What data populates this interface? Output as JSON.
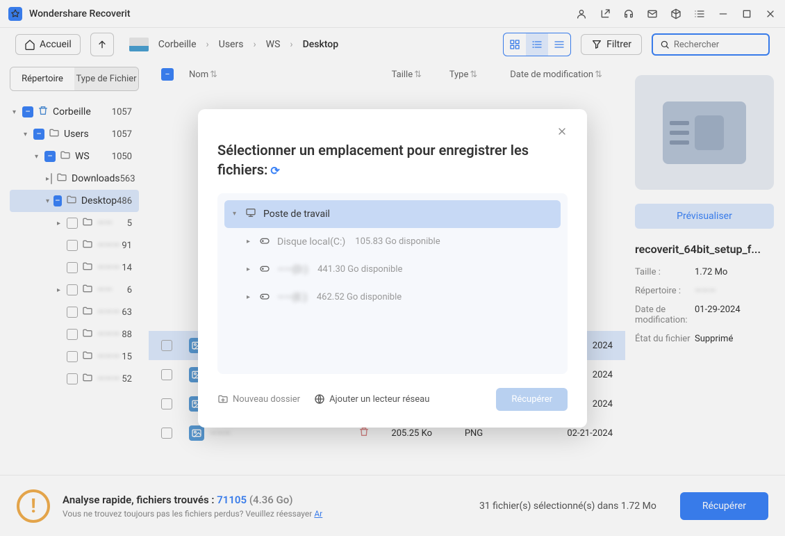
{
  "app": {
    "title": "Wondershare Recoverit"
  },
  "toolbar": {
    "home": "Accueil",
    "breadcrumbs": [
      "Corbeille",
      "Users",
      "WS",
      "Desktop"
    ],
    "filter": "Filtrer",
    "search_placeholder": "Rechercher"
  },
  "sidebar": {
    "tabs": {
      "dir": "Répertoire",
      "type": "Type de Fichier"
    },
    "tree": [
      {
        "indent": 0,
        "tri": "▾",
        "chk": "minus",
        "icon": "trash",
        "label": "Corbeille",
        "count": "1057"
      },
      {
        "indent": 1,
        "tri": "▾",
        "chk": "minus",
        "icon": "folder",
        "label": "Users",
        "count": "1057"
      },
      {
        "indent": 2,
        "tri": "▾",
        "chk": "minus",
        "icon": "folder",
        "label": "WS",
        "count": "1050"
      },
      {
        "indent": 3,
        "tri": "▸",
        "chk": "",
        "icon": "folder",
        "label": "Downloads",
        "count": "563"
      },
      {
        "indent": 3,
        "tri": "▾",
        "chk": "minus",
        "icon": "folder",
        "label": "Desktop",
        "count": "486",
        "sel": true
      },
      {
        "indent": 4,
        "tri": "▸",
        "chk": "",
        "icon": "folder",
        "label": "——",
        "count": "5",
        "blur": true
      },
      {
        "indent": 4,
        "tri": "",
        "chk": "",
        "icon": "folder",
        "label": "———",
        "count": "91",
        "blur": true
      },
      {
        "indent": 4,
        "tri": "",
        "chk": "",
        "icon": "folder",
        "label": "———",
        "count": "14",
        "blur": true
      },
      {
        "indent": 4,
        "tri": "▸",
        "chk": "",
        "icon": "folder",
        "label": "——",
        "count": "6",
        "blur": true
      },
      {
        "indent": 4,
        "tri": "",
        "chk": "",
        "icon": "folder",
        "label": "———",
        "count": "63",
        "blur": true
      },
      {
        "indent": 4,
        "tri": "",
        "chk": "",
        "icon": "folder",
        "label": "———",
        "count": "88",
        "blur": true
      },
      {
        "indent": 4,
        "tri": "",
        "chk": "",
        "icon": "folder",
        "label": "———",
        "count": "15",
        "blur": true
      },
      {
        "indent": 4,
        "tri": "",
        "chk": "",
        "icon": "folder",
        "label": "———",
        "count": "52",
        "blur": true
      }
    ]
  },
  "filelist": {
    "headers": {
      "nom": "Nom",
      "taille": "Taille",
      "type": "Type",
      "date": "Date de modification"
    },
    "rows": [
      {
        "name": "———",
        "size": "",
        "type": "",
        "date": "2024",
        "sel": true
      },
      {
        "name": "———",
        "size": "",
        "type": "",
        "date": "2024"
      },
      {
        "name": "———",
        "size": "",
        "type": "",
        "date": "2024"
      },
      {
        "name": "———",
        "size": "205.25 Ko",
        "type": "PNG",
        "date": "02-21-2024"
      }
    ]
  },
  "preview": {
    "btn": "Prévisualiser",
    "filename": "recoverit_64bit_setup_f...",
    "meta": [
      {
        "k": "Taille :",
        "v": "1.72 Mo"
      },
      {
        "k": "Répertoire :",
        "v": "———",
        "blur": true
      },
      {
        "k": "Date de modification:",
        "v": "01-29-2024"
      },
      {
        "k": "État du fichier",
        "v": "Supprimé"
      }
    ]
  },
  "status": {
    "title_prefix": "Analyse rapide, fichiers trouvés : ",
    "count": "71105",
    "size": "(4.36 Go)",
    "sub": "Vous ne trouvez toujours pas les fichiers perdus? Veuillez réessayer ",
    "sub_link": "Ar",
    "selected": "31 fichier(s) sélectionné(s) dans 1.72 Mo",
    "recover": "Récupérer"
  },
  "modal": {
    "title": "Sélectionner un emplacement pour enregistrer les fichiers:",
    "locations": [
      {
        "tri": "▾",
        "icon": "monitor",
        "name": "Poste de travail",
        "active": true
      },
      {
        "tri": "▸",
        "icon": "disk",
        "name": "Disque local(C:)",
        "dim": true,
        "free": "105.83 Go disponible",
        "indent": 1
      },
      {
        "tri": "▸",
        "icon": "disk",
        "name": "——(D:)",
        "dim": true,
        "blur": true,
        "free": "441.30 Go disponible",
        "indent": 1
      },
      {
        "tri": "▸",
        "icon": "disk",
        "name": "——(E:)",
        "dim": true,
        "blur": true,
        "free": "462.52 Go disponible",
        "indent": 1
      }
    ],
    "new_folder": "Nouveau dossier",
    "add_network": "Ajouter un lecteur réseau",
    "recover": "Récupérer"
  }
}
